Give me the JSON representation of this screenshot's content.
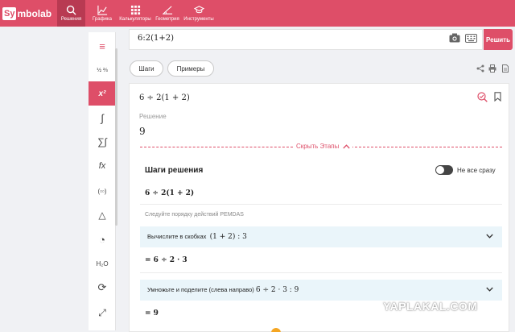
{
  "nav": {
    "logo_box": "Sy",
    "logo_rest": "mbolab",
    "items": [
      {
        "label": "Решения",
        "icon": "search-icon"
      },
      {
        "label": "Графика",
        "icon": "graph-icon"
      },
      {
        "label": "Калькуляторы",
        "icon": "calculator-icon"
      },
      {
        "label": "Геометрия",
        "icon": "angle-icon"
      },
      {
        "label": "Инструменты",
        "icon": "graduation-cap-icon"
      }
    ]
  },
  "sidebar": {
    "items": [
      {
        "label": "≡",
        "icon": "menu-icon"
      },
      {
        "label": "½ ⅔",
        "icon": "fractions-icon"
      },
      {
        "label": "x²",
        "icon": "algebra-icon"
      },
      {
        "label": "∫",
        "icon": "calculus-icon"
      },
      {
        "label": "∑∫",
        "icon": "series-icon"
      },
      {
        "label": "fx",
        "icon": "functions-icon"
      },
      {
        "label": "(▫▫)",
        "icon": "matrix-icon"
      },
      {
        "label": "△",
        "icon": "trigonometry-icon"
      },
      {
        "label": "◔",
        "icon": "statistics-icon"
      },
      {
        "label": "H₂O",
        "icon": "chemistry-icon"
      },
      {
        "label": "⟳",
        "icon": "finance-icon"
      },
      {
        "label": "⤢",
        "icon": "conversions-icon"
      }
    ]
  },
  "search": {
    "value": "6:2(1+2)",
    "solve_label": "Решить"
  },
  "tabs": {
    "steps": "Шаги",
    "examples": "Примеры"
  },
  "card": {
    "expression": "6 ÷ 2(1 + 2)",
    "solution_label": "Решение",
    "solution_value": "9",
    "hide_steps": "Скрыть Этапы",
    "steps_title": "Шаги решения",
    "toggle_label": "Не все сразу",
    "step_expr": "6 ÷ 2(1 + 2)",
    "rule": "Следуйте порядку действий PEMDAS",
    "step1_text": "Вычислите в скобках",
    "step1_expr": "(1 + 2) :  3",
    "step1_result": "= 6 ÷ 2 · 3",
    "step2_text": "Умножьте и поделите (слева направо)",
    "step2_expr": "6 ÷ 2 · 3 :  9",
    "step2_result": "= 9"
  },
  "watermark": "YAPLAKAL.COM",
  "colors": {
    "brand": "#de4e68",
    "brand_dark": "#b83a52",
    "step_bg": "#eaf5fa"
  }
}
